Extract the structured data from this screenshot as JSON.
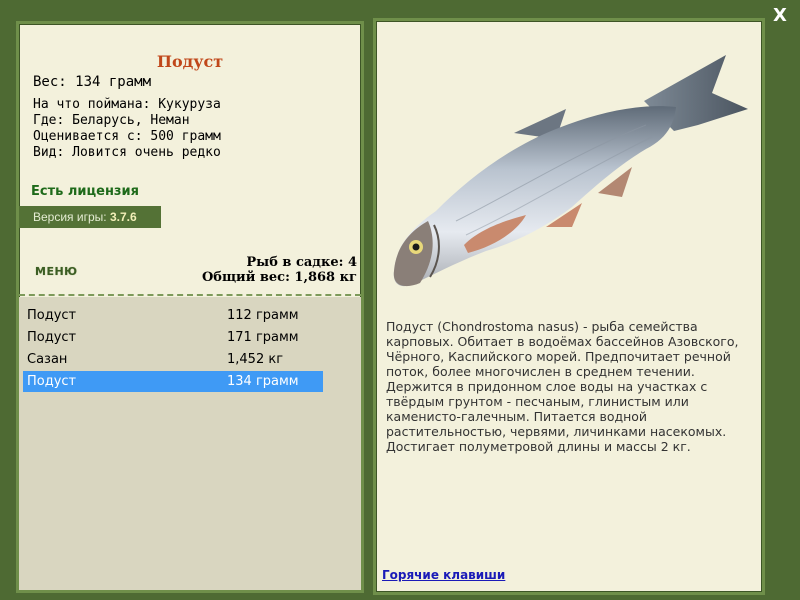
{
  "window": {
    "close_label": "X"
  },
  "fish": {
    "title": "Подуст",
    "weight": "Вес: 134 грамм",
    "details": [
      "На что поймана: Кукуруза",
      "Где: Беларусь, Неман",
      "Оценивается с: 500 грамм",
      "Вид: Ловится очень редко"
    ],
    "license": "Есть лицензия"
  },
  "version": {
    "label": "Версия игры:",
    "value": "3.7.6"
  },
  "menu": {
    "label": "МЕНЮ"
  },
  "stats": {
    "count_line": "Рыб в садке: 4",
    "total_line": "Общий вес: 1,868 кг"
  },
  "catch_list": [
    {
      "name": "Подуст",
      "weight": "112 грамм",
      "selected": false
    },
    {
      "name": "Подуст",
      "weight": "171 грамм",
      "selected": false
    },
    {
      "name": "Сазан",
      "weight": "1,452 кг",
      "selected": false
    },
    {
      "name": "Подуст",
      "weight": "134 грамм",
      "selected": true
    }
  ],
  "description": "Подуст (Chondrostoma nasus) - рыба семейства карповых. Обитает в водоёмах бассейнов Азовского, Чёрного, Каспийского морей. Предпочитает речной поток, более многочислен в среднем течении. Держится в придонном слое воды на участках с твёрдым грунтом - песчаным, глинистым или каменисто-галечным. Питается водной растительностью, червями, личинками насекомых. Достигает полуметровой длины и массы 2 кг.",
  "hotkeys": {
    "label": "Горячие клавиши"
  },
  "colors": {
    "frame": "#4e6a33",
    "panel": "#f3f1dc",
    "title": "#c0471a",
    "license": "#1e6a1a",
    "selection": "#3f9af5",
    "link": "#1a1ab8"
  }
}
